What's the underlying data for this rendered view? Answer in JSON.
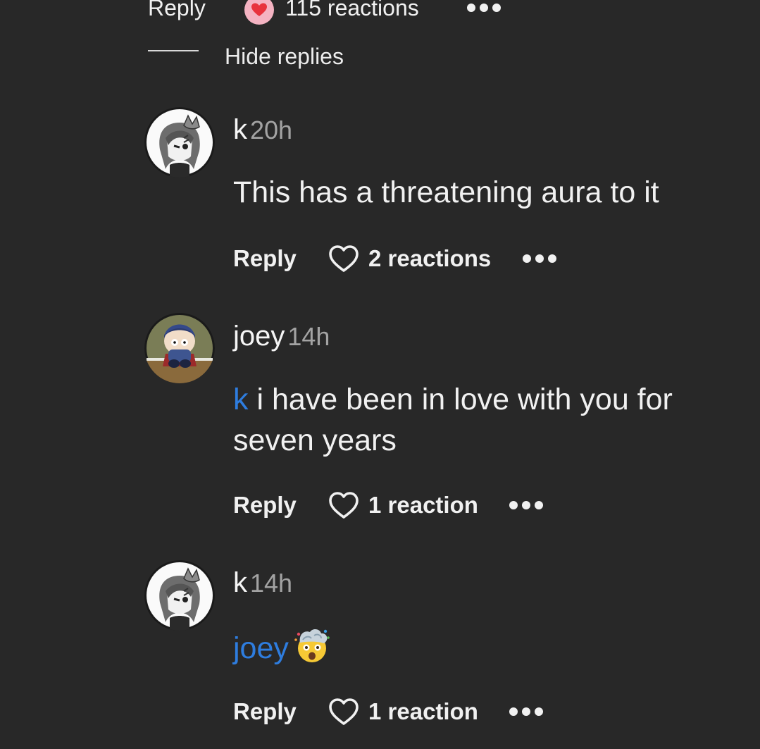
{
  "top_actions": {
    "reply_label": "Reply",
    "reactions_label": "115 reactions",
    "heart_icon": "filled-heart-reaction-icon",
    "more_icon": "more-dots-icon"
  },
  "hide_replies_label": "Hide replies",
  "comments": [
    {
      "username": "k",
      "time": "20h",
      "text": "This has a threatening aura to it",
      "reply_label": "Reply",
      "reactions_label": "2 reactions"
    },
    {
      "username": "joey",
      "time": "14h",
      "mention": "k",
      "text": " i have been in love with you for seven years",
      "reply_label": "Reply",
      "reactions_label": "1 reaction"
    },
    {
      "username": "k",
      "time": "14h",
      "mention": "joey",
      "emoji": "exploding-head-emoji",
      "reply_label": "Reply",
      "reactions_label": "1 reaction"
    }
  ],
  "colors": {
    "background": "#282828",
    "mention": "#2e7ddf",
    "timestamp": "#a3a3a3",
    "heart_badge": "#f4b3c2"
  }
}
